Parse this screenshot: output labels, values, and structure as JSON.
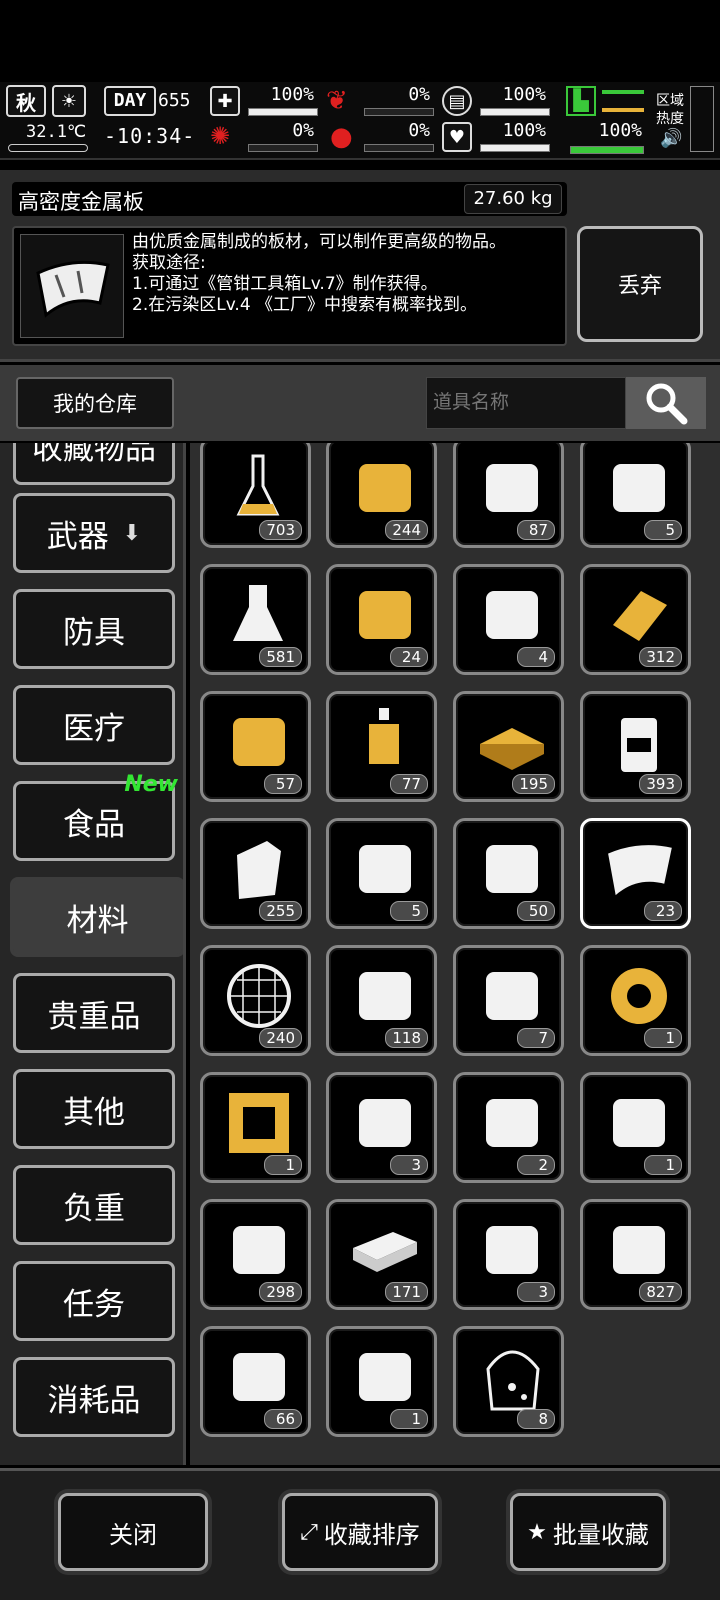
{
  "status": {
    "season": "秋",
    "temperature": "32.1℃",
    "day_label": "DAY",
    "day_number": "655",
    "time": "-10:34-",
    "stats": [
      {
        "id": "health",
        "value": "100%",
        "fill": 1.0
      },
      {
        "id": "hunger",
        "value": "0%",
        "fill": 0.0
      },
      {
        "id": "armor",
        "value": "100%",
        "fill": 1.0
      },
      {
        "id": "brain",
        "value": "0%",
        "fill": 0.0
      },
      {
        "id": "blood",
        "value": "0%",
        "fill": 0.0
      },
      {
        "id": "heart",
        "value": "100%",
        "fill": 1.0
      }
    ],
    "stamina_value": "100%",
    "stamina_fill": 1.0,
    "zone_label_1": "区域",
    "zone_label_2": "热度"
  },
  "detail": {
    "item_name": "高密度金属板",
    "weight": "27.60 kg",
    "description": "由优质金属制成的板材，可以制作更高级的物品。\n获取途径:\n1.可通过《管钳工具箱Lv.7》制作获得。\n2.在污染区Lv.4 《工厂》中搜索有概率找到。",
    "discard_label": "丢弃"
  },
  "warehouse": {
    "title": "我的仓库",
    "search_placeholder": "道具名称"
  },
  "categories": [
    {
      "label": "收藏物品",
      "partial": true
    },
    {
      "label": "武器",
      "arrow": true
    },
    {
      "label": "防具"
    },
    {
      "label": "医疗"
    },
    {
      "label": "食品",
      "badge": "New"
    },
    {
      "label": "材料",
      "selected": true
    },
    {
      "label": "贵重品"
    },
    {
      "label": "其他"
    },
    {
      "label": "负重"
    },
    {
      "label": "任务"
    },
    {
      "label": "消耗品"
    }
  ],
  "items": [
    {
      "icon": "flask-icon",
      "count": "703"
    },
    {
      "icon": "wood-planks-icon",
      "count": "244"
    },
    {
      "icon": "logs-icon",
      "count": "87"
    },
    {
      "icon": "pipe-fitting-icon",
      "count": "5"
    },
    {
      "icon": "beaker-icon",
      "count": "581"
    },
    {
      "icon": "gear-mechanism-icon",
      "count": "24"
    },
    {
      "icon": "cloth-icon",
      "count": "4"
    },
    {
      "icon": "gold-plate-icon",
      "count": "312"
    },
    {
      "icon": "gold-ore-icon",
      "count": "57"
    },
    {
      "icon": "potion-bottle-icon",
      "count": "77"
    },
    {
      "icon": "gold-bars-icon",
      "count": "195"
    },
    {
      "icon": "jerrycan-icon",
      "count": "393"
    },
    {
      "icon": "fuel-can-icon",
      "count": "255"
    },
    {
      "icon": "gun-parts-icon",
      "count": "5"
    },
    {
      "icon": "metal-scrap-icon",
      "count": "50"
    },
    {
      "icon": "metal-sheet-icon",
      "count": "23",
      "selected": true
    },
    {
      "icon": "mesh-filter-icon",
      "count": "240"
    },
    {
      "icon": "wood-log-icon",
      "count": "118"
    },
    {
      "icon": "vise-icon",
      "count": "7"
    },
    {
      "icon": "tape-roll-icon",
      "count": "1"
    },
    {
      "icon": "circuit-chip-icon",
      "count": "1"
    },
    {
      "icon": "rotor-icon",
      "count": "3"
    },
    {
      "icon": "scrap-parts-icon",
      "count": "2"
    },
    {
      "icon": "engine-icon",
      "count": "1"
    },
    {
      "icon": "cylinder-icon",
      "count": "298"
    },
    {
      "icon": "iron-ingot-icon",
      "count": "171"
    },
    {
      "icon": "battery-block-icon",
      "count": "3"
    },
    {
      "icon": "cables-icon",
      "count": "827"
    },
    {
      "icon": "plastic-bag-icon",
      "count": "66"
    },
    {
      "icon": "cartridge-icon",
      "count": "1"
    },
    {
      "icon": "seed-bag-icon",
      "count": "8"
    }
  ],
  "bottom": {
    "close_label": "关闭",
    "sort_label": "收藏排序",
    "batch_label": "批量收藏"
  },
  "colors": {
    "accent_gold": "#e8b33a",
    "new_badge": "#33e633",
    "stamina": "#3ac83a"
  }
}
